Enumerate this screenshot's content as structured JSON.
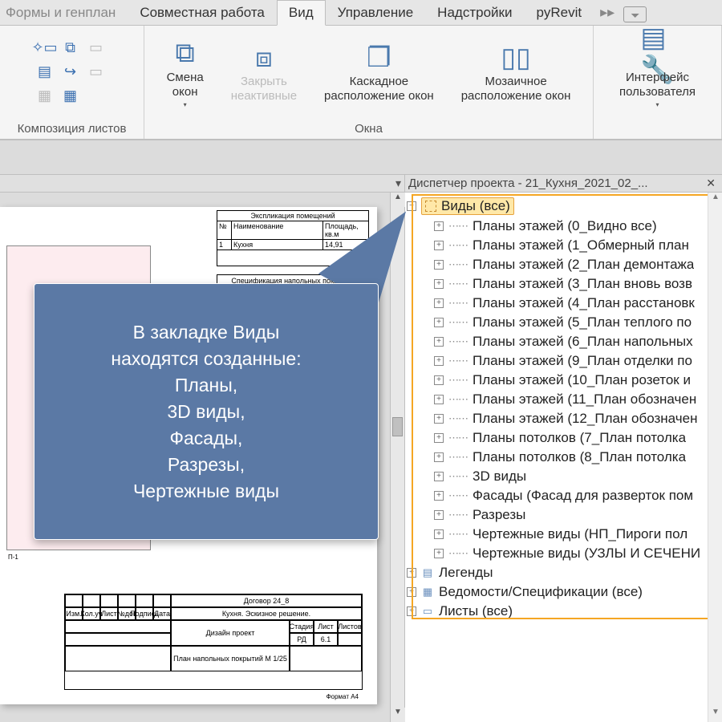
{
  "tabs": {
    "partial": "Формы и генплан",
    "collab": "Совместная работа",
    "view": "Вид",
    "manage": "Управление",
    "addins": "Надстройки",
    "pyrevit": "pyRevit"
  },
  "ribbon": {
    "group_sheets": "Композиция листов",
    "switch_windows": "Смена\nокон",
    "close_inactive": "Закрыть\nнеактивные",
    "cascade": "Каскадное\nрасположение окон",
    "tile": "Мозаичное\nрасположение окон",
    "group_windows": "Окна",
    "ui": "Интерфейс\nпользователя"
  },
  "panel": {
    "title": "Диспетчер проекта - 21_Кухня_2021_02_...",
    "root": "Виды (все)",
    "children": [
      "Планы этажей (0_Видно все)",
      "Планы этажей (1_Обмерный план",
      "Планы этажей (2_План демонтажа",
      "Планы этажей (3_План вновь возв",
      "Планы этажей (4_План расстановк",
      "Планы этажей (5_План теплого по",
      "Планы этажей (6_План напольных",
      "Планы этажей (9_План отделки по",
      "Планы этажей (10_План розеток и",
      "Планы этажей (11_План обозначен",
      "Планы этажей (12_План обозначен",
      "Планы потолков (7_План потолка",
      "Планы потолков (8_План потолка",
      "3D виды",
      "Фасады (Фасад для разверток пом",
      "Разрезы",
      "Чертежные виды (НП_Пироги пол",
      "Чертежные виды (УЗЛЫ И СЕЧЕНИ"
    ],
    "legends": "Легенды",
    "schedules": "Ведомости/Спецификации (все)",
    "sheets": "Листы (все)"
  },
  "callout": {
    "l1": "В закладке Виды",
    "l2": "находятся созданные:",
    "l3": "Планы,",
    "l4": "3D виды,",
    "l5": "Фасады,",
    "l6": "Разрезы,",
    "l7": "Чертежные виды"
  },
  "sheet": {
    "table1_title": "Экспликация помещений",
    "h_no": "№",
    "h_name": "Наименование",
    "h_area": "Площадь, кв.м",
    "r1_no": "1",
    "r1_name": "Кухня",
    "r1_area": "14,91",
    "table2_title": "Спецификация напольных покрытий",
    "plan_label": "П-1",
    "tb_contract": "Договор 24_8",
    "tb_subtitle": "Кухня. Эскизное решение.",
    "tb_project": "Дизайн проект",
    "tb_drawing": "План напольных покрытий М 1/25",
    "tb_stage": "РД",
    "tb_sheet": "6.1",
    "tb_format": "Формат А4",
    "h_izm": "Изм.",
    "h_kol": "Кол.уч",
    "h_list": "Лист",
    "h_doc": "№док",
    "h_sign": "Подпись",
    "h_date": "Дата",
    "h_stadia": "Стадия",
    "h_listov": "Лист",
    "h_total": "Листов"
  }
}
